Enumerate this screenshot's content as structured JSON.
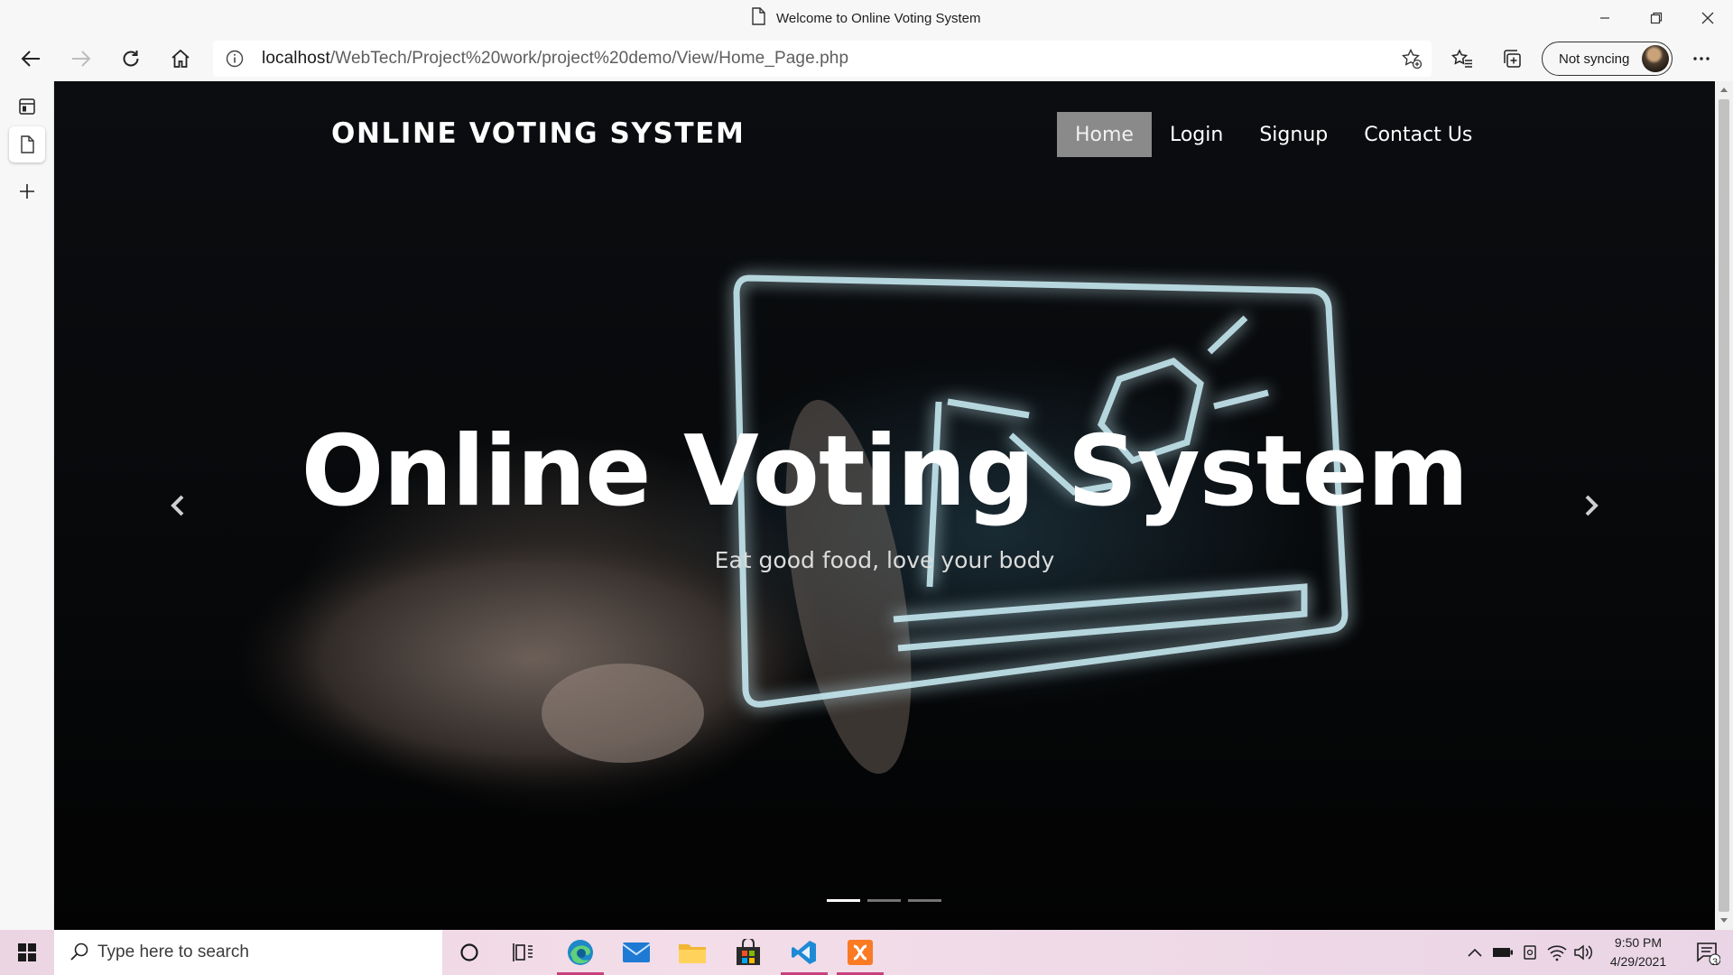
{
  "window": {
    "title": "Welcome to Online Voting System"
  },
  "browser": {
    "url_host": "localhost",
    "url_path": "/WebTech/Project%20work/project%20demo/View/Home_Page.php",
    "profile_label": "Not syncing"
  },
  "page": {
    "brand": "ONLINE VOTING SYSTEM",
    "menu": [
      {
        "label": "Home",
        "active": true
      },
      {
        "label": "Login",
        "active": false
      },
      {
        "label": "Signup",
        "active": false
      },
      {
        "label": "Contact Us",
        "active": false
      }
    ],
    "hero_title": "Online Voting System",
    "hero_subtitle": "Eat good food, love your body",
    "carousel_slides": 3,
    "carousel_active_index": 0
  },
  "taskbar": {
    "search_placeholder": "Type here to search",
    "time": "9:50 PM",
    "date": "4/29/2021",
    "notification_count": "3"
  },
  "colors": {
    "active_menu_bg": "#8a8a8a",
    "taskbar_accent": "#c8417c"
  }
}
